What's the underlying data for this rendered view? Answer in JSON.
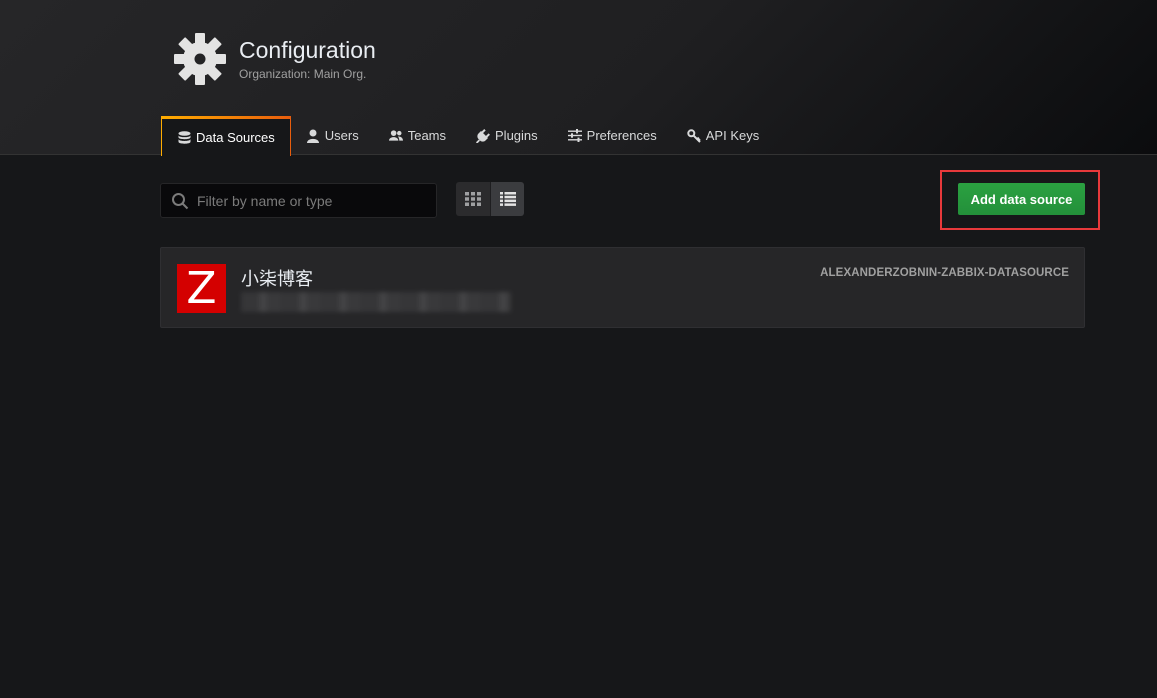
{
  "header": {
    "icon": "gear-icon",
    "title": "Configuration",
    "subtitle": "Organization: Main Org."
  },
  "tabs": [
    {
      "label": "Data Sources",
      "icon": "database-icon",
      "active": true
    },
    {
      "label": "Users",
      "icon": "user-icon",
      "active": false
    },
    {
      "label": "Teams",
      "icon": "users-icon",
      "active": false
    },
    {
      "label": "Plugins",
      "icon": "plug-icon",
      "active": false
    },
    {
      "label": "Preferences",
      "icon": "sliders-icon",
      "active": false
    },
    {
      "label": "API Keys",
      "icon": "key-icon",
      "active": false
    }
  ],
  "toolbar": {
    "search_placeholder": "Filter by name or type",
    "search_value": "",
    "view_mode": "list",
    "add_label": "Add data source"
  },
  "datasources": [
    {
      "logo_letter": "Z",
      "name": "小柒博客",
      "type": "ALEXANDERZOBNIN-ZABBIX-DATASOURCE"
    }
  ],
  "colors": {
    "accent_gradient_start": "#ffad00",
    "accent_gradient_end": "#e85d0d",
    "primary_button": "#299c3d",
    "highlight_border": "#e8393b",
    "logo_bg": "#d40000"
  }
}
